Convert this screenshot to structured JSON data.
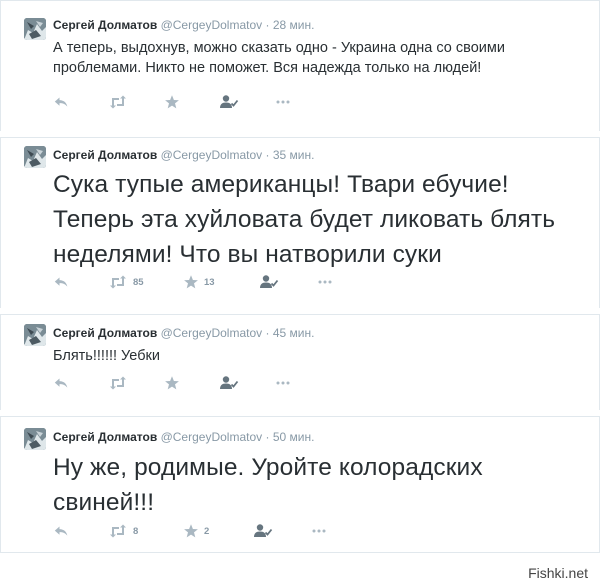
{
  "tweets": [
    {
      "author": "Сергей Долматов",
      "handle": "@CergeyDolmatov",
      "separator": "·",
      "time": "28 мин.",
      "text": "А теперь, выдохнув, можно сказать одно - Украина одна со своими проблемами. Никто не поможет. Вся надежда только на людей!",
      "retweets": "",
      "favorites": ""
    },
    {
      "author": "Сергей Долматов",
      "handle": "@CergeyDolmatov",
      "separator": "·",
      "time": "35 мин.",
      "text": "Сука тупые американцы! Твари ебучие! Теперь эта хуйловата будет ликовать блять неделями! Что вы натворили суки",
      "retweets": "85",
      "favorites": "13"
    },
    {
      "author": "Сергей Долматов",
      "handle": "@CergeyDolmatov",
      "separator": "·",
      "time": "45 мин.",
      "text": "Блять!!!!!! Уебки",
      "retweets": "",
      "favorites": ""
    },
    {
      "author": "Сергей Долматов",
      "handle": "@CergeyDolmatov",
      "separator": "·",
      "time": "50 мин.",
      "text": "Ну же, родимые. Уройте колорадских свиней!!!",
      "retweets": "8",
      "favorites": "2"
    }
  ],
  "icons": {
    "reply": "reply-icon",
    "retweet": "retweet-icon",
    "favorite": "star-icon",
    "follow": "follow-icon",
    "more": "more-icon"
  },
  "colors": {
    "icon": "#aab8c2",
    "meta": "#8899a6",
    "text": "#292f33"
  },
  "watermark": "Fishki.net"
}
